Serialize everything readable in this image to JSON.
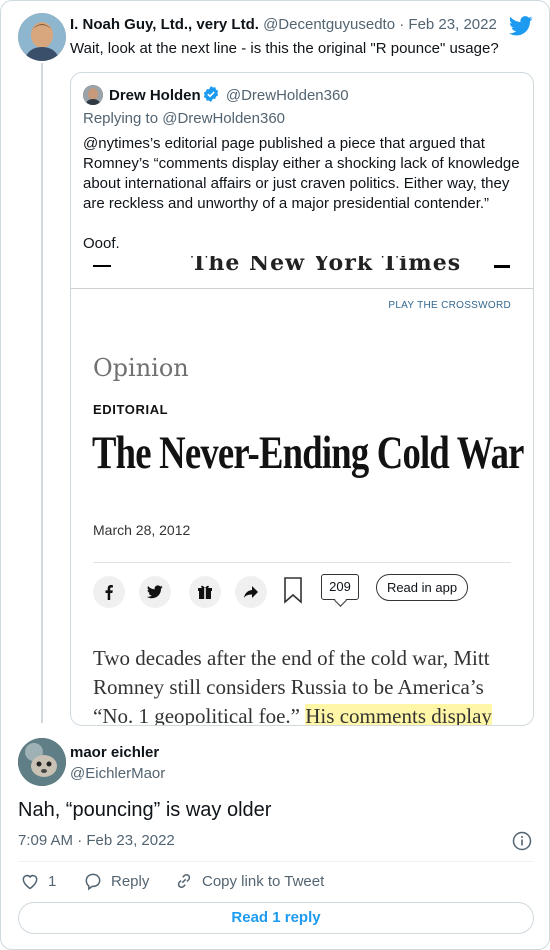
{
  "parent": {
    "name": "I. Noah Guy, Ltd., very Ltd.",
    "handle": "@Decentguyusedto",
    "separator": "·",
    "date": "Feb 23, 2022",
    "text": "Wait, look at the next line - is this the original \"R pounce\" usage?"
  },
  "quote": {
    "name": "Drew Holden",
    "handle": "@DrewHolden360",
    "replying_to": "Replying to @DrewHolden360",
    "text_line1": "@nytimes’s editorial page published a piece that argued that Romney’s “comments display either a shocking lack of knowledge about international affairs or just craven politics. Either way, they are reckless and unworthy of a major presidential contender.”",
    "text_line2": "Ooof."
  },
  "nyt": {
    "masthead": "The New York Times",
    "crossword": "PLAY THE CROSSWORD",
    "section": "Opinion",
    "label": "EDITORIAL",
    "headline": "The Never-Ending Cold War",
    "date": "March 28, 2012",
    "comments_count": "209",
    "read_in_app": "Read in app",
    "body_line1": "Two decades after the end of the cold war, Mitt",
    "body_line2": "Romney still considers Russia to be America’s",
    "body_line3_plain": "“No. 1 geopolitical foe.” ",
    "body_line3_highlight": "His comments display"
  },
  "reply": {
    "name": "maor eichler",
    "handle": "@EichlerMaor",
    "text": "Nah, “pouncing” is way older",
    "timestamp": "7:09 AM · Feb 23, 2022",
    "like_count": "1",
    "reply_label": "Reply",
    "copy_link_label": "Copy link to Tweet",
    "read_replies_label": "Read 1 reply"
  },
  "colors": {
    "twitter_blue": "#1d9bf0",
    "secondary_text": "#536471",
    "highlight": "#fff6a8"
  }
}
